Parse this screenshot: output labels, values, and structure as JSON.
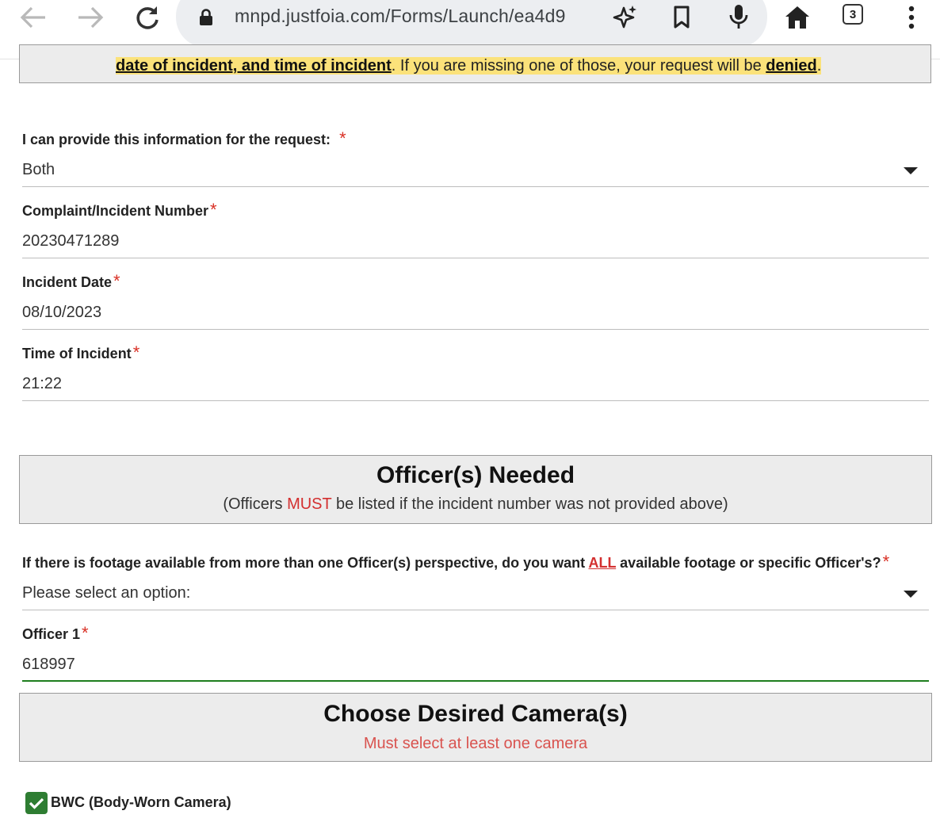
{
  "browser": {
    "url": "mnpd.justfoia.com/Forms/Launch/ea4d9",
    "tab_count": "3",
    "icons": [
      "back-icon",
      "forward-icon",
      "reload-icon",
      "lock-icon",
      "sparkle-icon",
      "bookmark-icon",
      "mic-icon",
      "home-icon",
      "tabs-icon",
      "more-icon"
    ]
  },
  "notice": {
    "bold_part": "date of incident, and time of incident",
    "middle": ". If you are missing one of those, your request will be ",
    "denied": "denied",
    "end": "."
  },
  "form": {
    "info_type": {
      "label": "I can provide this information for the request:",
      "required_mark": "*",
      "value": "Both"
    },
    "incident_number": {
      "label": "Complaint/Incident Number",
      "required_mark": "*",
      "value": "20230471289"
    },
    "incident_date": {
      "label": "Incident Date",
      "required_mark": "*",
      "value": "08/10/2023"
    },
    "incident_time": {
      "label": "Time of Incident",
      "required_mark": "*",
      "value": "21:22"
    },
    "footage_choice": {
      "label_before": "If there is footage available from more than one Officer(s) perspective, do you want ",
      "label_emph": "ALL",
      "label_after": " available footage or specific Officer's?",
      "required_mark": "*",
      "value": "Please select an option:"
    },
    "officer1": {
      "label": "Officer 1",
      "required_mark": "*",
      "value": "618997"
    }
  },
  "officers_section": {
    "title": "Officer(s) Needed",
    "sub_before": "(Officers ",
    "sub_emph": "MUST",
    "sub_after": " be listed if the incident number was not provided above)"
  },
  "camera_section": {
    "title": "Choose Desired Camera(s)",
    "warning": "Must select at least one camera"
  },
  "cameras": [
    {
      "label": "BWC (Body-Worn Camera)",
      "checked": true
    }
  ],
  "colors": {
    "accent_green": "#2e7d32",
    "required_red": "#d93025",
    "highlight": "#fbe27a"
  }
}
